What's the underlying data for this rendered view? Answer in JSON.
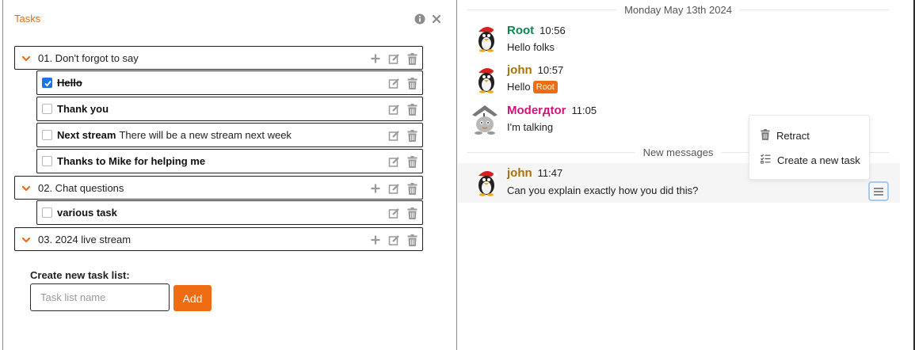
{
  "tasks_panel": {
    "title": "Tasks",
    "tasklists": [
      {
        "label": "01. Don't forgot to say",
        "tasks": [
          {
            "title": "Hello",
            "description": "",
            "done": true
          },
          {
            "title": "Thank you",
            "description": "",
            "done": false
          },
          {
            "title": "Next stream",
            "description": "There will be a new stream next week",
            "done": false
          },
          {
            "title": "Thanks to Mike for helping me",
            "description": "",
            "done": false
          }
        ]
      },
      {
        "label": "02. Chat questions",
        "tasks": [
          {
            "title": "various task",
            "description": "",
            "done": false
          }
        ]
      },
      {
        "label": "03. 2024 live stream",
        "tasks": []
      }
    ],
    "new_list": {
      "label": "Create new task list:",
      "placeholder": "Task list name",
      "button": "Add"
    }
  },
  "chat": {
    "date_separator": "Monday May 13th 2024",
    "new_messages_separator": "New messages",
    "messages": [
      {
        "author": "Root",
        "time": "10:56",
        "text": "Hello folks",
        "author_color": "#0b8a4f"
      },
      {
        "author": "john",
        "time": "10:57",
        "text": "Hello",
        "badge": "Root",
        "author_color": "#a8720a"
      },
      {
        "author": "Moderдtor",
        "time": "11:05",
        "text": "I'm talking",
        "author_color": "#d4137a"
      },
      {
        "author": "john",
        "time": "11:47",
        "text": "Can you explain exactly how you did this?",
        "author_color": "#a8720a"
      }
    ],
    "context_menu": {
      "retract": "Retract",
      "create_task": "Create a new task"
    }
  },
  "colors": {
    "accent": "#f06c12",
    "checkbox_checked": "#1a73e8",
    "icon_gray": "#9a9a9a"
  }
}
